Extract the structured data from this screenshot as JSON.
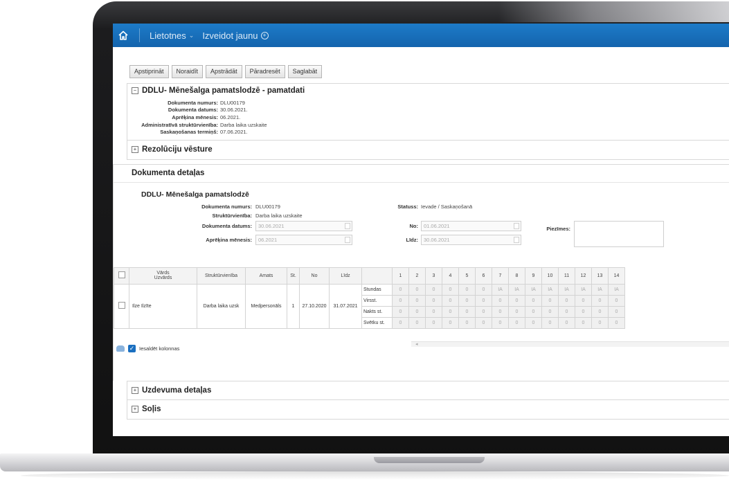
{
  "nav": {
    "item1": "Lietotnes",
    "item2": "Izveidot jaunu"
  },
  "toolbar": {
    "buttons": [
      "Apstiprināt",
      "Noraidīt",
      "Apstrādāt",
      "Pāradresēt",
      "Saglabāt"
    ]
  },
  "section_main": {
    "title": "DDLU- Mēnešalga pamatslodzē - pamatdati",
    "toggle": "−",
    "fields": [
      {
        "label": "Dokumenta numurs:",
        "value": "DLU00179"
      },
      {
        "label": "Dokumenta datums:",
        "value": "30.06.2021."
      },
      {
        "label": "Aprēķina mēnesis:",
        "value": "06.2021."
      },
      {
        "label": "Administratīvā struktūrvienība:",
        "value": "Darba laika uzskaite"
      },
      {
        "label": "Saskaņošanas termiņš:",
        "value": "07.06.2021."
      }
    ]
  },
  "section_history": {
    "title": "Rezolūciju vēsture",
    "toggle": "+"
  },
  "details": {
    "header": "Dokumenta detaļas",
    "doc_title": "DDLU- Mēnešalga pamatslodzē",
    "doc_number_label": "Dokumenta numurs:",
    "doc_number_value": "DLU00179",
    "unit_label": "Struktūrvienība:",
    "unit_value": "Darba laika uzskaite",
    "doc_date_label": "Dokumenta datums:",
    "doc_date_value": "30.06.2021",
    "calc_month_label": "Aprēķina mēnesis:",
    "calc_month_value": "06.2021",
    "status_label": "Statuss:",
    "status_value": "Ievade / Saskaņošanā",
    "from_label": "No:",
    "from_value": "01.06.2021",
    "to_label": "Līdz:",
    "to_value": "30.06.2021",
    "notes_label": "Piezīmes:"
  },
  "grid": {
    "headers": {
      "name_top": "Vārds",
      "name_bottom": "Uzvārds",
      "unit": "Struktūrvienība",
      "position": "Amats",
      "count": "St.",
      "from": "No",
      "to": "Līdz"
    },
    "days": [
      "1",
      "2",
      "3",
      "4",
      "5",
      "6",
      "7",
      "8",
      "9",
      "10",
      "11",
      "12",
      "13",
      "14"
    ],
    "row": {
      "name": "Ilze Ilzīte",
      "unit": "Darba laika uzsk",
      "position": "Medpersonāls",
      "count": "1",
      "from": "27.10.2020",
      "to": "31.07.2021"
    },
    "sub_rows": [
      {
        "label": "Stundas",
        "values": [
          "0",
          "0",
          "0",
          "0",
          "0",
          "0",
          "IA",
          "IA",
          "IA",
          "IA",
          "IA",
          "IA",
          "IA",
          "IA"
        ]
      },
      {
        "label": "Virsst.",
        "values": [
          "0",
          "0",
          "0",
          "0",
          "0",
          "0",
          "0",
          "0",
          "0",
          "0",
          "0",
          "0",
          "0",
          "0"
        ]
      },
      {
        "label": "Nakts st.",
        "values": [
          "0",
          "0",
          "0",
          "0",
          "0",
          "0",
          "0",
          "0",
          "0",
          "0",
          "0",
          "0",
          "0",
          "0"
        ]
      },
      {
        "label": "Svētku st.",
        "values": [
          "0",
          "0",
          "0",
          "0",
          "0",
          "0",
          "0",
          "0",
          "0",
          "0",
          "0",
          "0",
          "0",
          "0"
        ]
      }
    ],
    "freeze_label": "Iesaldēt kolonnas",
    "freeze_checked": "✓"
  },
  "section_task": {
    "title": "Uzdevuma detaļas",
    "toggle": "+"
  },
  "section_steps": {
    "title": "Soļis",
    "toggle": "+"
  }
}
